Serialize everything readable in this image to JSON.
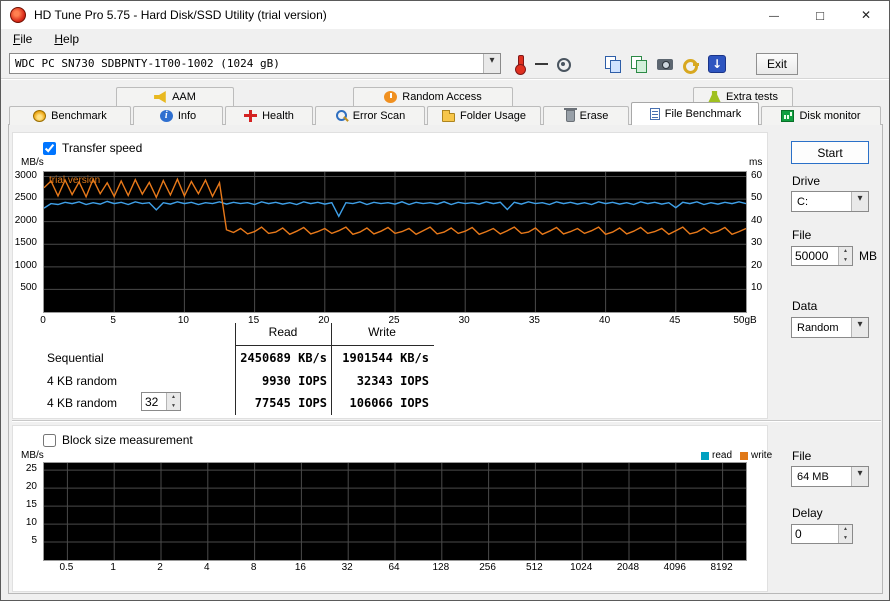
{
  "window": {
    "title": "HD Tune Pro 5.75 - Hard Disk/SSD Utility (trial version)"
  },
  "menu": {
    "items": [
      {
        "label": "File"
      },
      {
        "label": "Help"
      }
    ]
  },
  "toolbar": {
    "drive_combo_value": "WDC PC SN730 SDBPNTY-1T00-1002 (1024 gB)",
    "exit_label": "Exit"
  },
  "tabs": {
    "row1": [
      {
        "label": "AAM"
      },
      {
        "label": "Random Access"
      },
      {
        "label": "Extra tests"
      }
    ],
    "row2": [
      {
        "label": "Benchmark"
      },
      {
        "label": "Info"
      },
      {
        "label": "Health"
      },
      {
        "label": "Error Scan"
      },
      {
        "label": "Folder Usage"
      },
      {
        "label": "Erase"
      },
      {
        "label": "File Benchmark",
        "active": true
      },
      {
        "label": "Disk monitor"
      }
    ]
  },
  "file_benchmark": {
    "transfer_speed_label": "Transfer speed",
    "transfer_checked": true,
    "trial_watermark": "trial version",
    "table": {
      "headers": {
        "read": "Read",
        "write": "Write"
      },
      "rows": [
        {
          "label": "Sequential",
          "read": "2450689 KB/s",
          "write": "1901544 KB/s"
        },
        {
          "label": "4 KB random",
          "read": "9930 IOPS",
          "write": "32343 IOPS"
        },
        {
          "label": "4 KB random",
          "read": "77545 IOPS",
          "write": "106066 IOPS"
        }
      ],
      "queue_depth": "32"
    },
    "controls": {
      "start": "Start",
      "drive_label": "Drive",
      "drive_value": "C:",
      "file_label": "File",
      "file_size": "50000",
      "file_unit": "MB",
      "data_label": "Data",
      "data_value": "Random"
    }
  },
  "block_size": {
    "label": "Block size measurement",
    "checked": false,
    "legend": [
      {
        "label": "read",
        "color": "#00a0c0"
      },
      {
        "label": "write",
        "color": "#e07818"
      }
    ],
    "controls": {
      "file_label": "File",
      "file_value": "64 MB",
      "delay_label": "Delay",
      "delay_value": "0"
    }
  },
  "chart_data": [
    {
      "type": "line",
      "title": "Transfer speed",
      "x_unit": "GB",
      "x_max": 50,
      "x_step": 0.5,
      "x_tick_positions": [
        0,
        5,
        10,
        15,
        20,
        25,
        30,
        35,
        40,
        45,
        50
      ],
      "x_tick_labels": [
        "0",
        "5",
        "10",
        "15",
        "20",
        "25",
        "30",
        "35",
        "40",
        "45",
        "50gB"
      ],
      "ylabel_left": "MB/s",
      "ylim_left": [
        0,
        3100
      ],
      "y_ticks_left": [
        3000,
        2500,
        2000,
        1500,
        1000,
        500
      ],
      "ylabel_right": "ms",
      "ylim_right": [
        0,
        62
      ],
      "y_ticks_right": [
        60,
        50,
        40,
        30,
        20,
        10
      ],
      "grid": true,
      "series": [
        {
          "name": "read",
          "color": "#3fa0e8",
          "values": [
            2300,
            2400,
            2380,
            2430,
            2400,
            2440,
            2380,
            2420,
            2390,
            2450,
            2400,
            2430,
            2380,
            2440,
            2400,
            2420,
            2260,
            2420,
            2390,
            2440,
            2400,
            2430,
            2380,
            2420,
            2400,
            2440,
            2390,
            2430,
            2400,
            2420,
            2380,
            2440,
            2400,
            2430,
            2390,
            2420,
            2380,
            2440,
            2400,
            2430,
            2390,
            2420,
            2120,
            2420,
            2400,
            2440,
            2380,
            2430,
            2400,
            2420,
            2390,
            2440,
            2380,
            2430,
            2400,
            2420,
            2390,
            2440,
            2380,
            2430,
            2400,
            2420,
            2390,
            2440,
            2400,
            2430,
            2270,
            2430,
            2390,
            2440,
            2400,
            2420,
            2380,
            2440,
            2400,
            2430,
            2390,
            2420,
            2380,
            2440,
            2400,
            2430,
            2390,
            2420,
            2380,
            2440,
            2400,
            2430,
            2390,
            2420,
            2310,
            2430,
            2400,
            2440,
            2380,
            2420,
            2390,
            2430,
            2400,
            2440,
            2400
          ]
        },
        {
          "name": "write",
          "color": "#e8791a",
          "values": [
            2750,
            2900,
            2570,
            2920,
            2600,
            2880,
            2550,
            2940,
            2620,
            2860,
            2560,
            2900,
            2580,
            2930,
            2610,
            2870,
            2540,
            2910,
            2590,
            2940,
            2570,
            2890,
            2620,
            2920,
            2560,
            2860,
            1820,
            1760,
            1850,
            1730,
            1780,
            1880,
            1740,
            1770,
            1860,
            1720,
            1790,
            1870,
            1730,
            1780,
            1850,
            1740,
            1800,
            1880,
            1720,
            1770,
            1860,
            1730,
            1790,
            1870,
            1740,
            1780,
            1850,
            1720,
            1800,
            1880,
            1730,
            1770,
            1860,
            1740,
            1790,
            1870,
            1720,
            1780,
            1850,
            1730,
            1800,
            1880,
            1740,
            1770,
            1860,
            1720,
            1790,
            1870,
            1730,
            1780,
            1850,
            1740,
            1800,
            1880,
            1720,
            1770,
            1860,
            1730,
            1790,
            1870,
            1740,
            1780,
            1850,
            1720,
            1800,
            1880,
            1730,
            1770,
            1860,
            1740,
            1790,
            1870,
            1720,
            1780,
            1850
          ]
        }
      ]
    },
    {
      "type": "line",
      "title": "Block size measurement",
      "ylabel": "MB/s",
      "ylim": [
        0,
        27
      ],
      "y_ticks": [
        25,
        20,
        15,
        10,
        5
      ],
      "categories": [
        "0.5",
        "1",
        "2",
        "4",
        "8",
        "16",
        "32",
        "64",
        "128",
        "256",
        "512",
        "1024",
        "2048",
        "4096",
        "8192"
      ],
      "grid": true,
      "series": []
    }
  ]
}
